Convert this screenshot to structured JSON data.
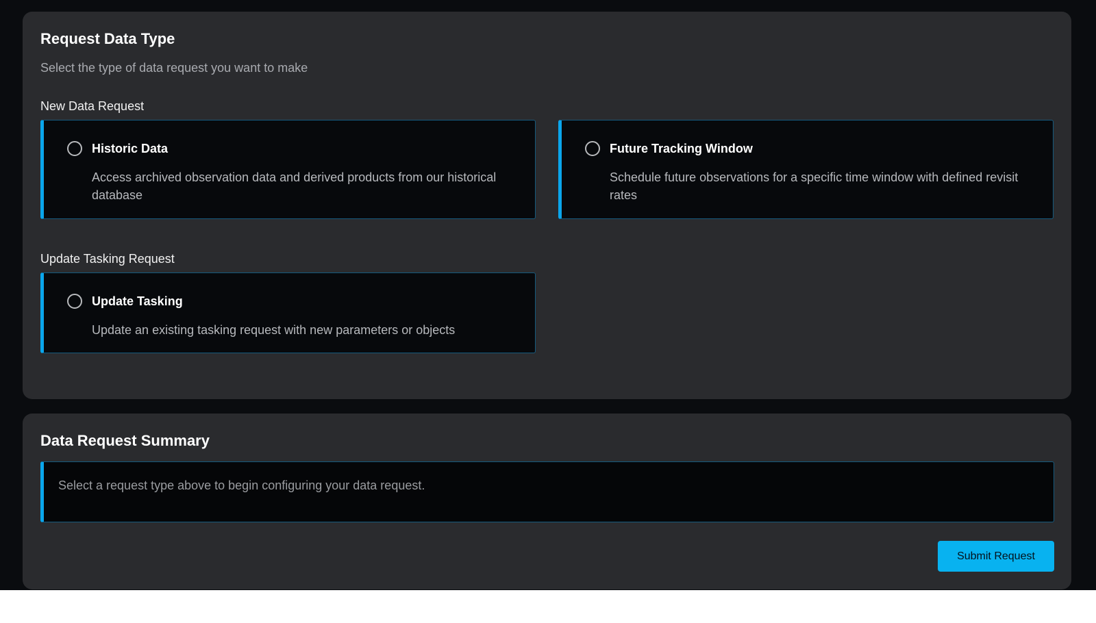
{
  "request_type_panel": {
    "title": "Request Data Type",
    "subtitle": "Select the type of data request you want to make",
    "new_group": {
      "label": "New Data Request",
      "options": [
        {
          "title": "Historic Data",
          "description": "Access archived observation data and derived products from our historical database",
          "selected": false
        },
        {
          "title": "Future Tracking Window",
          "description": "Schedule future observations for a specific time window with defined revisit rates",
          "selected": false
        }
      ]
    },
    "update_group": {
      "label": "Update Tasking Request",
      "options": [
        {
          "title": "Update Tasking",
          "description": "Update an existing tasking request with new parameters or objects",
          "selected": false
        }
      ]
    }
  },
  "summary_panel": {
    "title": "Data Request Summary",
    "placeholder_text": "Select a request type above to begin configuring your data request.",
    "submit_label": "Submit Request"
  },
  "colors": {
    "accent": "#0aa6ec",
    "panel_bg": "#2a2b2e",
    "page_bg": "#0a0c0f",
    "card_bg": "#07090c"
  }
}
